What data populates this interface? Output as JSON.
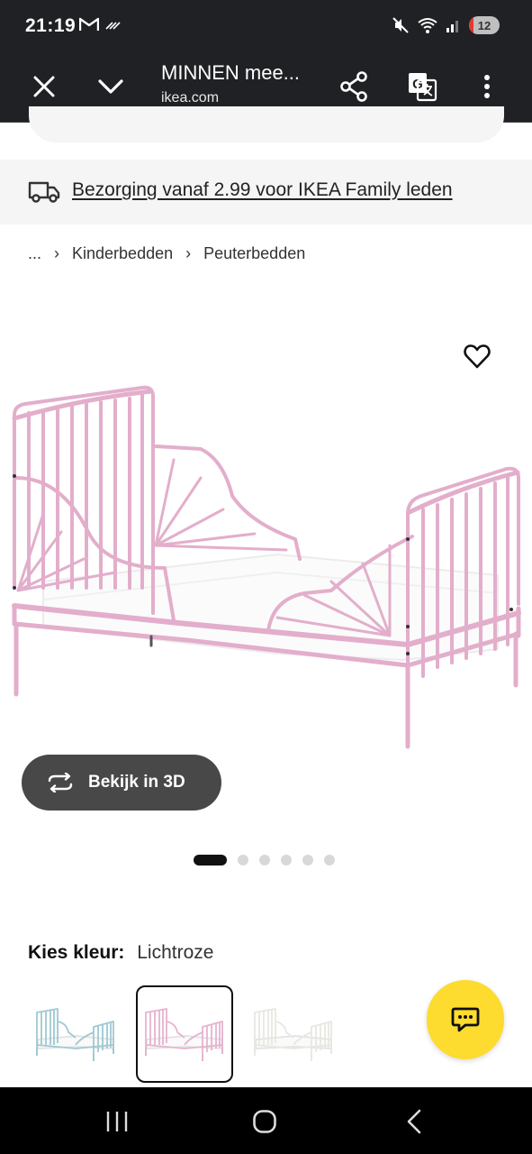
{
  "status_bar": {
    "time": "21:19",
    "battery_level": "12"
  },
  "browser": {
    "page_title": "MINNEN mee...",
    "domain": "ikea.com"
  },
  "delivery_banner": {
    "text": "Bezorging vanaf 2.99 voor IKEA Family leden"
  },
  "breadcrumb": {
    "ellipsis": "...",
    "items": [
      "Kinderbedden",
      "Peuterbedden"
    ]
  },
  "product": {
    "view_3d_label": "Bekijk in 3D",
    "gallery_total": 6,
    "gallery_active_index": 0,
    "bed_color_hex": "#e6b3cf"
  },
  "color_picker": {
    "label": "Kies kleur:",
    "selected_value": "Lichtroze",
    "swatches": [
      {
        "color": "#9fc9d2"
      },
      {
        "color": "#e6b3cf"
      },
      {
        "color": "#e8e8e2"
      }
    ],
    "selected_index": 1
  },
  "colors": {
    "chrome_bg": "#202124",
    "banner_bg": "#f5f5f5",
    "chat_fab": "#fddb2f",
    "button_3d_bg": "#484848"
  }
}
